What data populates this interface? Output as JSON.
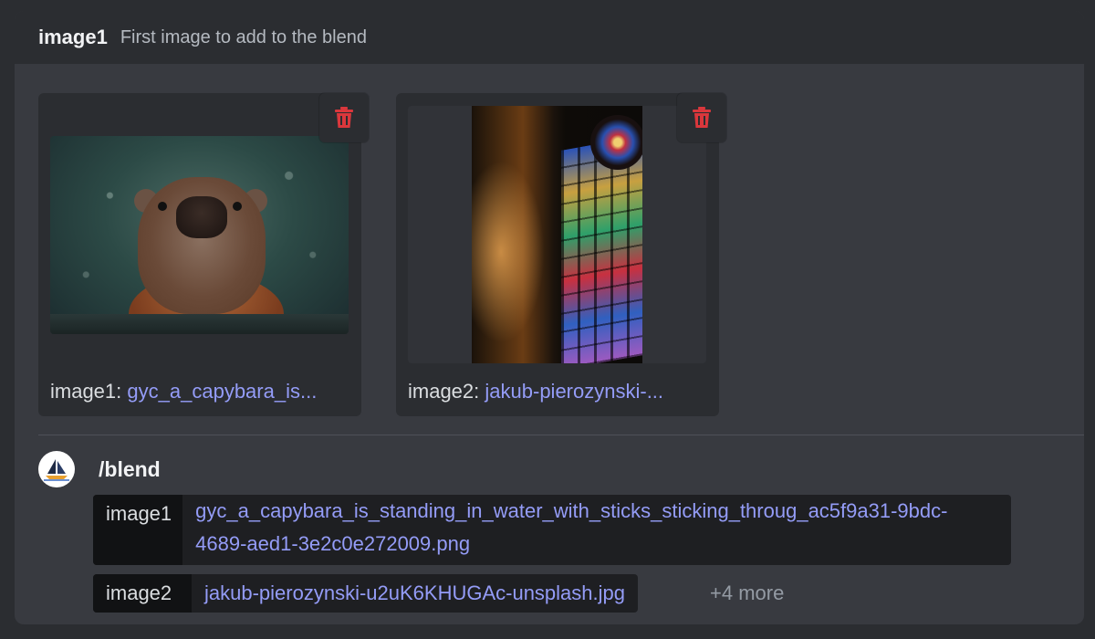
{
  "header": {
    "option_name": "image1",
    "option_description": "First image to add to the blend"
  },
  "attachments": [
    {
      "label": "image1:",
      "filename": "gyc_a_capybara_is..."
    },
    {
      "label": "image2:",
      "filename": "jakub-pierozynski-..."
    }
  ],
  "command": {
    "name": "/blend",
    "options": [
      {
        "key": "image1",
        "value": "gyc_a_capybara_is_standing_in_water_with_sticks_sticking_throug_ac5f9a31-9bdc-4689-aed1-3e2c0e272009.png"
      },
      {
        "key": "image2",
        "value": "jakub-pierozynski-u2uK6KHUGAc-unsplash.jpg"
      }
    ],
    "more_label": "+4 more"
  },
  "colors": {
    "link": "#949cf7",
    "danger": "#da373c"
  }
}
